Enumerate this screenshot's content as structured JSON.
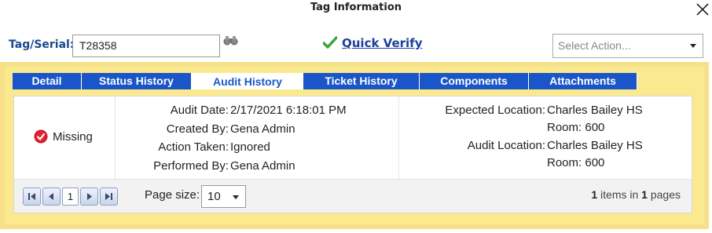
{
  "dialog": {
    "title": "Tag Information"
  },
  "tag": {
    "label": "Tag/Serial:",
    "value": "T28358"
  },
  "quick_verify": {
    "label": "Quick Verify"
  },
  "action_select": {
    "placeholder": "Select Action..."
  },
  "tabs": [
    {
      "label": "Detail",
      "active": false
    },
    {
      "label": "Status History",
      "active": false
    },
    {
      "label": "Audit History",
      "active": true
    },
    {
      "label": "Ticket History",
      "active": false
    },
    {
      "label": "Components",
      "active": false
    },
    {
      "label": "Attachments",
      "active": false
    }
  ],
  "audit_row": {
    "status": "Missing",
    "audit_date_label": "Audit Date:",
    "audit_date": "2/17/2021 6:18:01 PM",
    "created_by_label": "Created By:",
    "created_by": "Gena Admin",
    "action_taken_label": "Action Taken:",
    "action_taken": "Ignored",
    "performed_by_label": "Performed By:",
    "performed_by": "Gena Admin",
    "expected_location_label": "Expected Location:",
    "expected_location_line1": "Charles Bailey HS",
    "expected_location_line2": "Room: 600",
    "audit_location_label": "Audit Location:",
    "audit_location_line1": "Charles Bailey HS",
    "audit_location_line2": "Room: 600"
  },
  "pager": {
    "current_page": "1",
    "page_size_label": "Page size:",
    "page_size": "10",
    "items_count": "1",
    "items_text": "items in",
    "pages_count": "1",
    "pages_text": "pages"
  },
  "colors": {
    "tab_blue": "#1a56c8",
    "panel_yellow": "#fbe98f",
    "link_blue": "#1b3f9a",
    "label_blue": "#1a4a8a",
    "missing_red": "#c8102e",
    "check_green": "#3aa63a"
  },
  "icons": {
    "close": "close-icon",
    "binoculars": "binoculars-icon",
    "quick_verify": "checkmark-icon",
    "missing": "missing-status-icon",
    "first": "first-page-icon",
    "prev": "prev-page-icon",
    "next": "next-page-icon",
    "last": "last-page-icon"
  }
}
